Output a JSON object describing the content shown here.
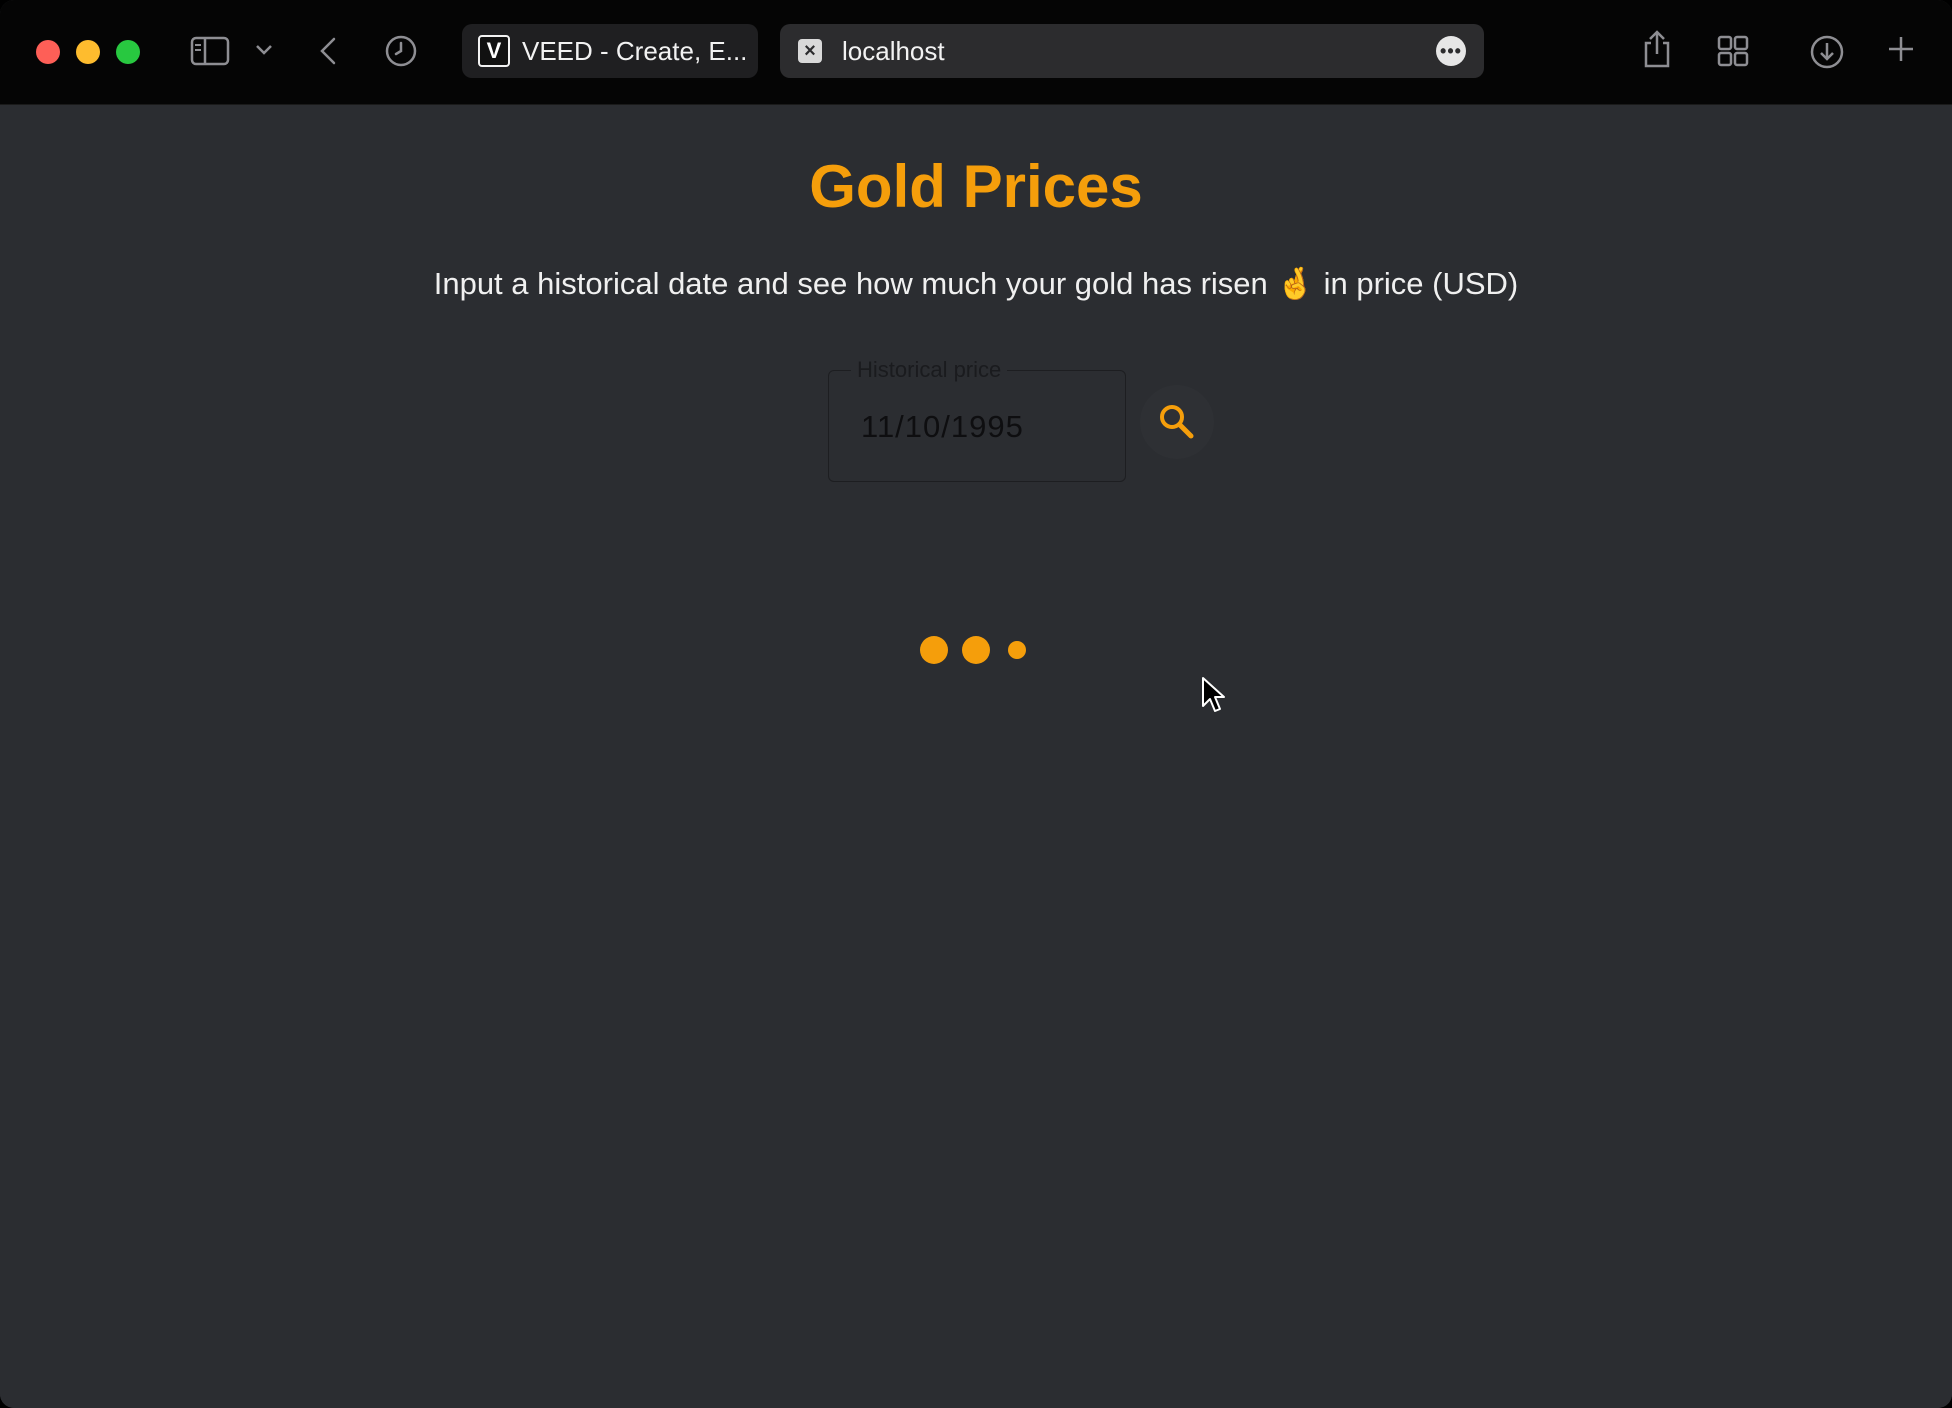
{
  "browser": {
    "tabs": [
      {
        "label": "VEED - Create, E...",
        "favicon": "V"
      },
      {
        "label": "localhost",
        "favicon": "x-icon"
      }
    ],
    "colors": {
      "close": "#fe5f57",
      "minimize": "#febc2e",
      "zoom": "#28c840"
    }
  },
  "page": {
    "title": "Gold Prices",
    "subtitle_before": "Input a historical date and see how much your gold has risen ",
    "subtitle_emoji": "🤞",
    "subtitle_after": " in price (USD)",
    "date_field": {
      "label": "Historical price",
      "value": "11/10/1995"
    },
    "accent_color": "#f59e0b",
    "loading_indicator": "three-dot-loader"
  }
}
